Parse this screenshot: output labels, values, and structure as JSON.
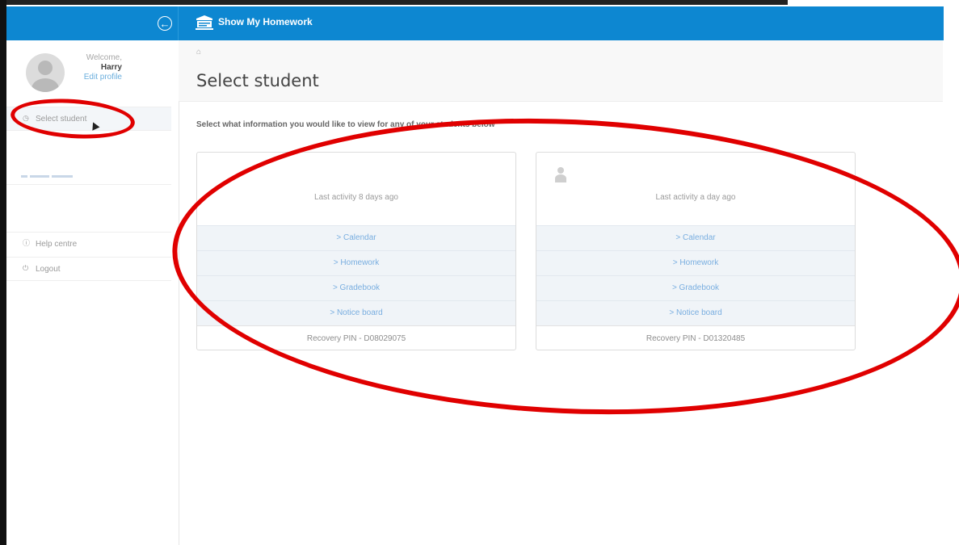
{
  "app": {
    "title": "Show My Homework"
  },
  "sidebar": {
    "welcome": "Welcome,",
    "user_name": "Harry",
    "edit_profile": "Edit profile",
    "items": [
      {
        "label": "Select student",
        "icon": "clock-icon"
      },
      {
        "label": "Help centre",
        "icon": "question-icon"
      },
      {
        "label": "Logout",
        "icon": "power-icon"
      }
    ]
  },
  "page": {
    "title": "Select student",
    "instruction": "Select what information you would like to view for any of your students below"
  },
  "cards": [
    {
      "activity": "Last activity 8 days ago",
      "links": [
        "> Calendar",
        "> Homework",
        "> Gradebook",
        "> Notice board"
      ],
      "recovery_pin": "Recovery PIN - D08029075"
    },
    {
      "activity": "Last activity a day ago",
      "links": [
        "> Calendar",
        "> Homework",
        "> Gradebook",
        "> Notice board"
      ],
      "recovery_pin": "Recovery PIN - D01320485"
    }
  ],
  "colors": {
    "brand_blue": "#0d87d1",
    "link_blue": "#79aee0",
    "annotation_red": "#e00000"
  }
}
